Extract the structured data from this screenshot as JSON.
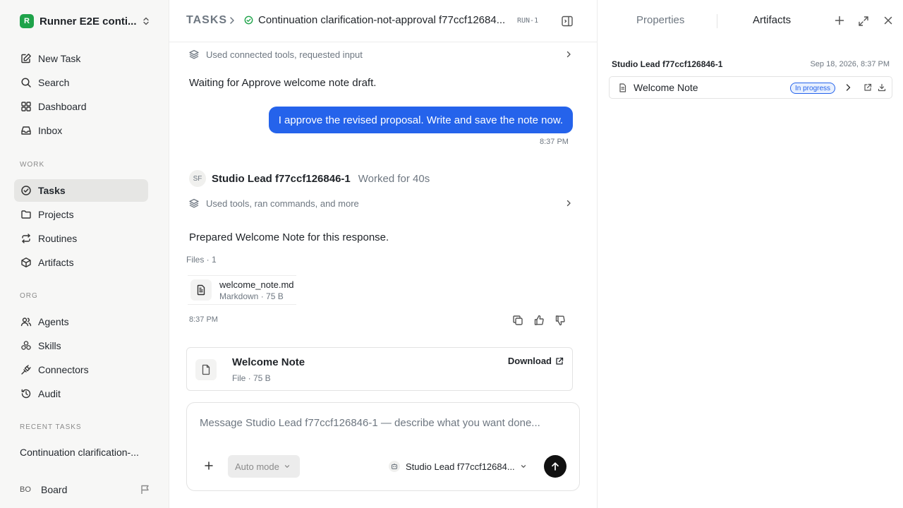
{
  "workspace": {
    "logo_letter": "R",
    "name": "Runner E2E conti..."
  },
  "nav": [
    {
      "label": "New Task",
      "icon": "pencil-square-icon"
    },
    {
      "label": "Search",
      "icon": "search-icon"
    },
    {
      "label": "Dashboard",
      "icon": "grid-icon"
    },
    {
      "label": "Inbox",
      "icon": "inbox-icon"
    }
  ],
  "sections": {
    "work": "WORK",
    "org": "ORG",
    "recent": "RECENT TASKS"
  },
  "work_nav": [
    {
      "label": "Tasks",
      "icon": "check-circle-icon",
      "active": true
    },
    {
      "label": "Projects",
      "icon": "folder-icon"
    },
    {
      "label": "Routines",
      "icon": "repeat-icon"
    },
    {
      "label": "Artifacts",
      "icon": "cube-icon"
    }
  ],
  "org_nav": [
    {
      "label": "Agents",
      "icon": "users-icon"
    },
    {
      "label": "Skills",
      "icon": "skills-icon"
    },
    {
      "label": "Connectors",
      "icon": "plug-icon"
    },
    {
      "label": "Audit",
      "icon": "history-icon"
    }
  ],
  "recent_tasks": [
    "Continuation clarification-..."
  ],
  "user": {
    "initials": "BO",
    "name": "Board"
  },
  "header": {
    "root": "TASKS",
    "title": "Continuation clarification-not-approval f77ccf12684...",
    "run": "RUN-1"
  },
  "thread": {
    "trace1": "Used connected tools, requested input",
    "waiting": "Waiting for Approve welcome note draft.",
    "user_message": "I approve the revised proposal. Write and save the note now.",
    "user_time": "8:37 PM",
    "agent": {
      "initials": "SF",
      "name": "Studio Lead f77ccf126846-1",
      "duration": "Worked for 40s"
    },
    "trace2": "Used tools, ran commands, and more",
    "response": "Prepared Welcome Note for this response.",
    "files_label": "Files · 1",
    "file": {
      "name": "welcome_note.md",
      "meta": "Markdown · 75 B"
    },
    "response_time": "8:37 PM"
  },
  "artifact_card": {
    "title": "Welcome Note",
    "meta": "File · 75 B",
    "download": "Download"
  },
  "composer": {
    "placeholder": "Message Studio Lead f77ccf126846-1 — describe what you want done...",
    "mode": "Auto mode",
    "agent": "Studio Lead f77ccf12684..."
  },
  "panel": {
    "tabs": [
      "Properties",
      "Artifacts"
    ],
    "group": {
      "title": "Studio Lead f77ccf126846-1",
      "date": "Sep 18, 2026, 8:37 PM"
    },
    "artifact": {
      "name": "Welcome Note",
      "status": "In progress"
    }
  },
  "colors": {
    "accent": "#2563eb",
    "brand": "#1fa34a",
    "active_nav": "#e6e6e4"
  }
}
